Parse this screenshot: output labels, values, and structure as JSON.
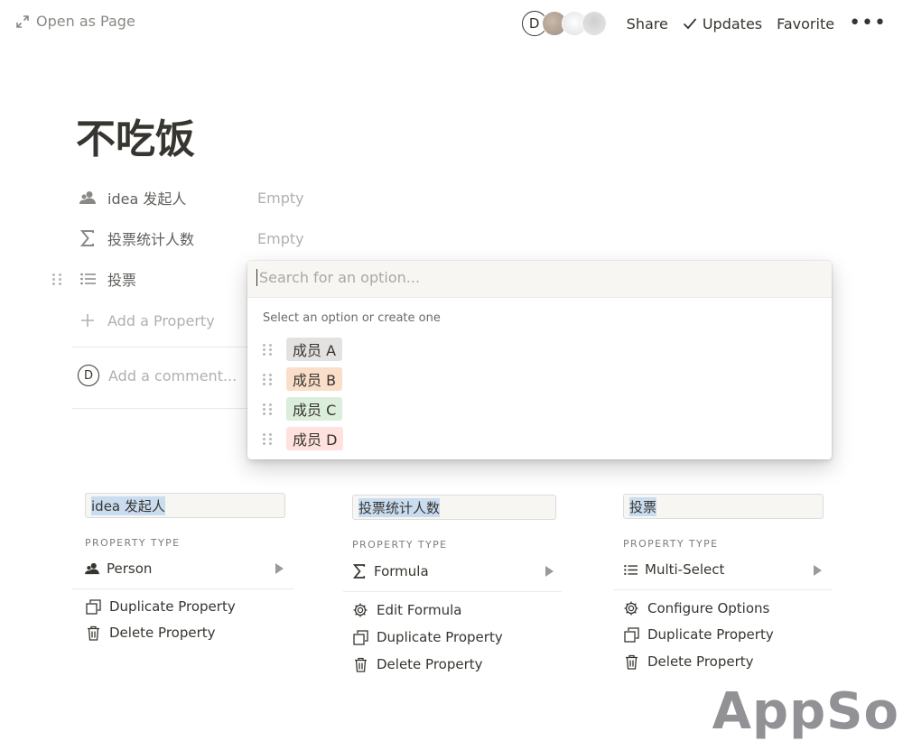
{
  "topbar": {
    "open_as_page": "Open as Page",
    "avatar_initial": "D",
    "share": "Share",
    "updates": "Updates",
    "favorite": "Favorite",
    "more": "•••"
  },
  "page": {
    "title": "不吃饭"
  },
  "properties": [
    {
      "name": "idea 发起人",
      "value": "Empty",
      "icon": "person-icon"
    },
    {
      "name": "投票统计人数",
      "value": "Empty",
      "icon": "sigma-icon"
    },
    {
      "name": "投票",
      "value": "",
      "icon": "list-icon"
    }
  ],
  "add_property": "Add a Property",
  "comment": {
    "avatar_initial": "D",
    "placeholder": "Add a comment..."
  },
  "dropdown": {
    "search_placeholder": "Search for an option...",
    "hint": "Select an option or create one",
    "options": [
      {
        "label": "成员 A",
        "color": "#e3e2e0"
      },
      {
        "label": "成员 B",
        "color": "#fadec9"
      },
      {
        "label": "成员 C",
        "color": "#dbeddb"
      },
      {
        "label": "成员 D",
        "color": "#ffe2dd"
      }
    ]
  },
  "editors": [
    {
      "name": "idea 发起人",
      "property_type_label": "PROPERTY TYPE",
      "type": "Person",
      "type_icon": "person-icon",
      "actions": [
        {
          "label": "Duplicate Property",
          "icon": "duplicate-icon"
        },
        {
          "label": "Delete Property",
          "icon": "trash-icon"
        }
      ]
    },
    {
      "name": "投票统计人数",
      "property_type_label": "PROPERTY TYPE",
      "type": "Formula",
      "type_icon": "sigma-icon",
      "actions": [
        {
          "label": "Edit Formula",
          "icon": "gear-icon"
        },
        {
          "label": "Duplicate Property",
          "icon": "duplicate-icon"
        },
        {
          "label": "Delete Property",
          "icon": "trash-icon"
        }
      ]
    },
    {
      "name": "投票",
      "property_type_label": "PROPERTY TYPE",
      "type": "Multi-Select",
      "type_icon": "list-icon",
      "actions": [
        {
          "label": "Configure Options",
          "icon": "gear-icon"
        },
        {
          "label": "Duplicate Property",
          "icon": "duplicate-icon"
        },
        {
          "label": "Delete Property",
          "icon": "trash-icon"
        }
      ]
    }
  ],
  "watermark": "AppSo"
}
